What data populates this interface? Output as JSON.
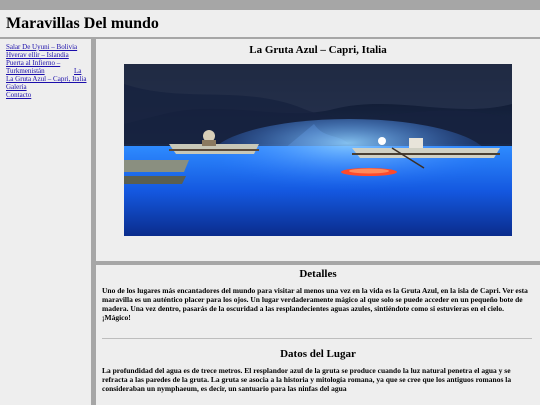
{
  "site": {
    "title": "Maravillas Del mundo"
  },
  "nav": {
    "items": [
      {
        "label": "Salar De Uyuni – Bolivia"
      },
      {
        "label": "Hverav ellir – Islandia"
      },
      {
        "label": "La"
      },
      {
        "label": "Puerta al Infierno – Turkmenistán"
      },
      {
        "label": "La Gruta Azul – Capri, Italia"
      },
      {
        "label": "Galería"
      },
      {
        "label": "Contacto"
      }
    ]
  },
  "article": {
    "title": "La Gruta Azul – Capri, Italia",
    "image_alt": "Barcas en la Gruta Azul de Capri iluminada por el agua azul"
  },
  "details": {
    "heading": "Detalles",
    "text": "Uno de los lugares más encantadores del mundo para visitar al menos una vez en la vida es la Gruta Azul, en la isla de Capri. Ver esta maravilla es un auténtico placer para los ojos. Un lugar verdaderamente mágico al que solo se puede acceder en un pequeño bote de madera. Una vez dentro, pasarás de la oscuridad a las resplandecientes aguas azules, sintiéndote como si estuvieras en el cielo. ¡Mágico!"
  },
  "facts": {
    "heading": "Datos del Lugar",
    "text": "La profundidad del agua es de trece metros. El resplandor azul de la gruta se produce cuando la luz natural penetra el agua y se refracta a las paredes de la gruta. La gruta se asocia a la historia y mitología romana, ya que se cree que los antiguos romanos la consideraban un nymphaeum, es decir, un santuario para las ninfas del agua"
  },
  "colors": {
    "frame": "#a6a6a6",
    "panel": "#eeeeee",
    "link": "#1a0dab",
    "water": "#1e6bff"
  }
}
